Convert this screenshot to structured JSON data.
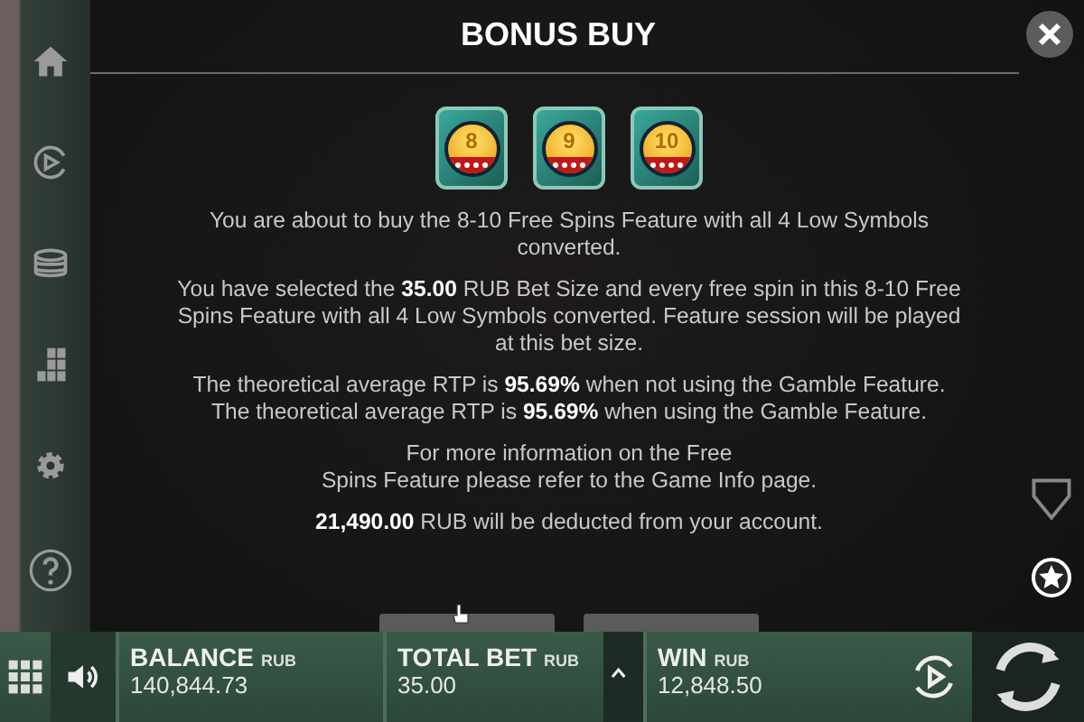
{
  "dialog": {
    "title": "BONUS BUY",
    "symbols": [
      {
        "label": "8"
      },
      {
        "label": "9"
      },
      {
        "label": "10"
      }
    ],
    "paragraphs": [
      "You are about to buy the 8-10 Free Spins Feature with all 4 Low Symbols converted.",
      "You have selected the **35.00** RUB Bet Size and every free spin in this 8-10 Free Spins Feature with all 4 Low Symbols converted. Feature session will be played at this bet size.",
      "The theoretical average RTP is **95.69%** when not using the Gamble Feature.\nThe theoretical average RTP is **95.69%** when using the Gamble Feature.",
      "For more information on the Free\nSpins Feature please refer to the Game Info page.",
      "**21,490.00** RUB will be deducted from your account."
    ]
  },
  "bottom_bar": {
    "fields": [
      {
        "label": "BALANCE",
        "currency": "RUB",
        "value": "140,844.73"
      },
      {
        "label": "TOTAL BET",
        "currency": "RUB",
        "value": "35.00"
      },
      {
        "label": "WIN",
        "currency": "RUB",
        "value": "12,848.50"
      }
    ]
  }
}
